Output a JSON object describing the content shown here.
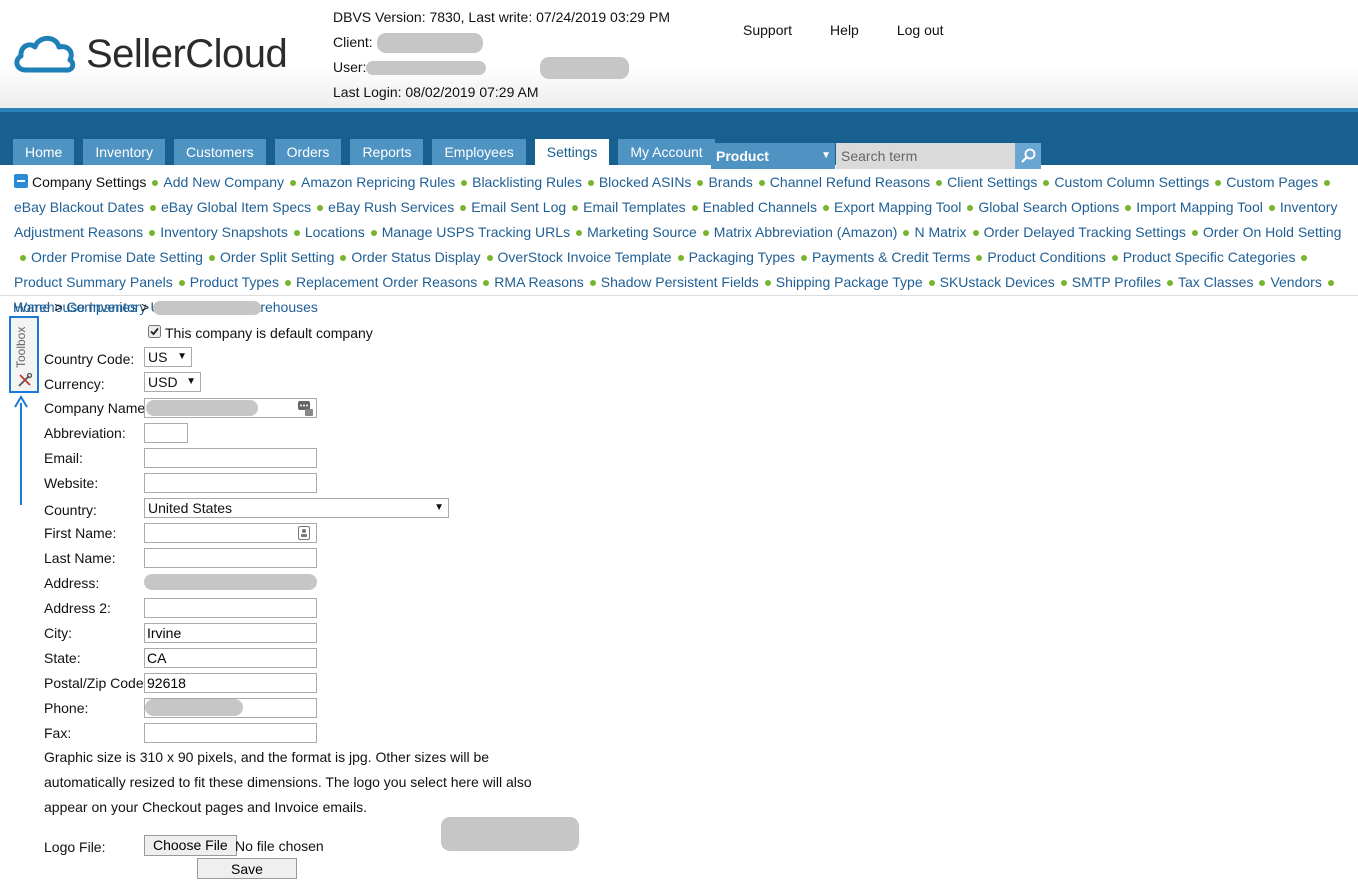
{
  "header": {
    "brand": "SellerCloud",
    "version_line": "DBVS Version: 7830, Last write: 07/24/2019 03:29 PM",
    "client_label": "Client:",
    "user_label": "User:",
    "last_login": "Last Login: 08/02/2019 07:29 AM",
    "links": [
      "Support",
      "Help",
      "Log out"
    ]
  },
  "nav": {
    "tabs": [
      "Home",
      "Inventory",
      "Customers",
      "Orders",
      "Reports",
      "Employees",
      "Settings",
      "My Account"
    ],
    "active_tab": "Settings",
    "product_select": "Product",
    "search_placeholder": "Search term"
  },
  "submenu": {
    "title": "Company Settings",
    "items": [
      "Add New Company",
      "Amazon Repricing Rules",
      "Blacklisting Rules",
      "Blocked ASINs",
      "Brands",
      "Channel Refund Reasons",
      "Client Settings",
      "Custom Column Settings",
      "Custom Pages",
      "eBay Blackout Dates",
      "eBay Global Item Specs",
      "eBay Rush Services",
      "Email Sent Log",
      "Email Templates",
      "Enabled Channels",
      "Export Mapping Tool",
      "Global Search Options",
      "Import Mapping Tool",
      "Inventory Adjustment Reasons",
      "Inventory Snapshots",
      "Locations",
      "Manage USPS Tracking URLs",
      "Marketing Source",
      "Matrix Abbreviation (Amazon)",
      "N Matrix",
      "Order Delayed Tracking Settings",
      "Order On Hold Setting",
      "Order Promise Date Setting",
      "Order Split Setting",
      "Order Status Display",
      "OverStock Invoice Template",
      "Packaging Types",
      "Payments & Credit Terms",
      "Product Conditions",
      "Product Specific Categories",
      "Product Summary Panels",
      "Product Types",
      "Replacement Order Reasons",
      "RMA Reasons",
      "Shadow Persistent Fields",
      "Shipping Package Type",
      "SKUstack Devices",
      "SMTP Profiles",
      "Tax Classes",
      "Vendors",
      "Warehouse Inventory Update Log",
      "Warehouses"
    ]
  },
  "breadcrumb": {
    "home": "Home",
    "sep": ">",
    "companies": "Companies"
  },
  "toolbox": {
    "label": "Toolbox"
  },
  "form": {
    "default_company": "This company is default company",
    "country_code_label": "Country Code:",
    "country_code": "US",
    "currency_label": "Currency:",
    "currency": "USD",
    "company_name_label": "Company Name:",
    "abbreviation_label": "Abbreviation:",
    "email_label": "Email:",
    "website_label": "Website:",
    "country_label": "Country:",
    "country": "United States",
    "first_name_label": "First Name:",
    "last_name_label": "Last Name:",
    "address_label": "Address:",
    "address2_label": "Address 2:",
    "city_label": "City:",
    "city": "Irvine",
    "state_label": "State:",
    "state": "CA",
    "zip_label": "Postal/Zip Code:",
    "zip": "92618",
    "phone_label": "Phone:",
    "fax_label": "Fax:",
    "note": "Graphic size is 310 x 90 pixels, and the format is jpg. Other sizes will be automatically resized to fit these dimensions. The logo you select here will also appear on your Checkout pages and Invoice emails.",
    "logo_label": "Logo File:",
    "choose_file": "Choose File",
    "no_file": "No file chosen",
    "save": "Save"
  }
}
